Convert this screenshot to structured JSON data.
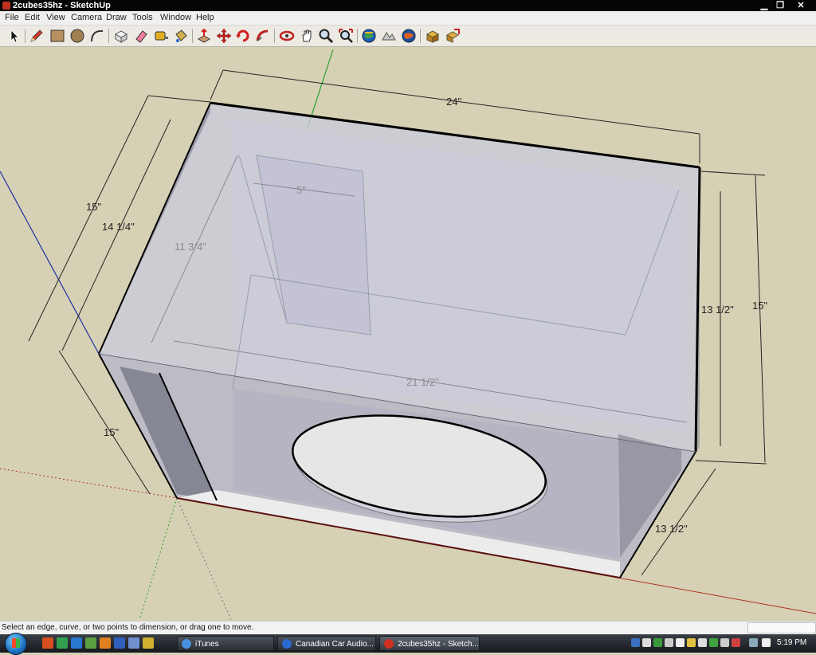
{
  "window": {
    "title": "2cubes35hz - SketchUp",
    "controls": [
      "▁",
      "❐",
      "✕"
    ]
  },
  "menu": [
    "File",
    "Edit",
    "View",
    "Camera",
    "Draw",
    "Tools",
    "Window",
    "Help"
  ],
  "toolbar": {
    "tools": [
      "select-tool",
      "pencil-tool",
      "rectangle-tool",
      "circle-tool",
      "arc-tool",
      "make-component-tool",
      "eraser-tool",
      "tape-measure-tool",
      "paint-bucket-tool",
      "push-pull-tool",
      "move-tool",
      "rotate-tool",
      "follow-me-tool",
      "orbit-tool",
      "pan-tool",
      "zoom-tool",
      "zoom-extents-tool",
      "add-location-tool",
      "toggle-terrain-tool",
      "google-earth-tool",
      "get-models-tool",
      "share-model-tool"
    ]
  },
  "dimensions": {
    "top_width": "24\"",
    "left_height_outer": "15\"",
    "left_height_inner": "14 1/4\"",
    "depth_left": "15\"",
    "inner_height_ghost": "11 3/4\"",
    "port_width_ghost": "5\"",
    "inner_width_ghost": "21 1/2\"",
    "right_inner_height": "13 1/2\"",
    "right_outer_height": "15\"",
    "bottom_depth": "13 1/2\""
  },
  "statusbar": {
    "message": "Select an edge, curve, or two points to dimension, or drag one to move."
  },
  "taskbar": {
    "tasks": [
      "iTunes",
      "Canadian Car Audio...",
      "2cubes35hz - Sketch..."
    ],
    "clock": "5:19 PM"
  },
  "colors": {
    "viewport_bg": "#d6d1b4",
    "box_face": "#c7c7d6",
    "box_edge": "#000000",
    "axis_green": "#2aa02a",
    "axis_blue": "#1f2fa0",
    "axis_red": "#b03020"
  }
}
